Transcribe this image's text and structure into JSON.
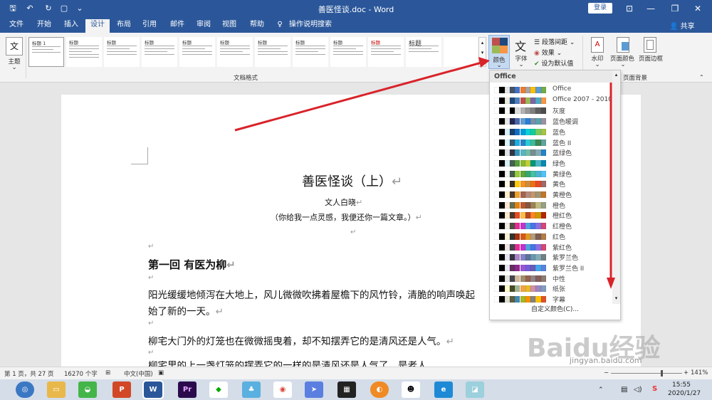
{
  "titlebar": {
    "document_title": "善医怪谈.doc - Word",
    "login_label": "登录",
    "share_label": "共享"
  },
  "tabs": [
    "文件",
    "开始",
    "插入",
    "设计",
    "布局",
    "引用",
    "邮件",
    "审阅",
    "视图",
    "帮助",
    "操作说明搜索"
  ],
  "ribbon": {
    "theme_label": "主题",
    "styles_group_label": "文档格式",
    "thumb_titles": [
      "标题 1",
      "标题",
      "标题",
      "标题",
      "标题",
      "标题",
      "标题",
      "标题",
      "标题",
      "标题",
      "标题"
    ],
    "colors_label": "颜色",
    "fonts_label": "字体",
    "paragraph_spacing_label": "段落间距",
    "effects_label": "效果",
    "set_default_label": "设为默认值",
    "watermark_label": "水印",
    "page_color_label": "页面颜色",
    "page_border_label": "页面边框",
    "page_bg_group_label": "页面背景"
  },
  "colors_dropdown": {
    "header": "Office",
    "custom_label": "自定义颜色(C)...",
    "items": [
      {
        "name": "Office",
        "colors": [
          "#ffffff",
          "#000000",
          "#e7e6e6",
          "#44546a",
          "#4472c4",
          "#ed7d31",
          "#a5a5a5",
          "#ffc000",
          "#5b9bd5",
          "#70ad47"
        ]
      },
      {
        "name": "Office 2007 - 2010",
        "colors": [
          "#ffffff",
          "#000000",
          "#eeece1",
          "#1f497d",
          "#4f81bd",
          "#c0504d",
          "#9bbb59",
          "#8064a2",
          "#4bacc6",
          "#f79646"
        ]
      },
      {
        "name": "灰度",
        "colors": [
          "#ffffff",
          "#000000",
          "#f8f8f8",
          "#000000",
          "#dddddd",
          "#b2b2b2",
          "#969696",
          "#808080",
          "#5f5f5f",
          "#4d4d4d"
        ]
      },
      {
        "name": "蓝色暖调",
        "colors": [
          "#ffffff",
          "#000000",
          "#e7e6e6",
          "#242852",
          "#4a66ac",
          "#629dd1",
          "#297fd5",
          "#7f8fa9",
          "#5aa2ae",
          "#9d90a0"
        ]
      },
      {
        "name": "蓝色",
        "colors": [
          "#ffffff",
          "#000000",
          "#dbeff9",
          "#17406d",
          "#0f6fc6",
          "#009dd9",
          "#0bd0d9",
          "#10cf9b",
          "#7cca62",
          "#a5c249"
        ]
      },
      {
        "name": "蓝色 II",
        "colors": [
          "#ffffff",
          "#000000",
          "#dbf5f9",
          "#335b74",
          "#1cade4",
          "#2683c6",
          "#27ced7",
          "#42ba97",
          "#3e8853",
          "#62a39f"
        ]
      },
      {
        "name": "蓝绿色",
        "colors": [
          "#ffffff",
          "#000000",
          "#dfe3e5",
          "#373545",
          "#3494ba",
          "#58b6c0",
          "#75bda7",
          "#7a8c8e",
          "#84acb6",
          "#2683c6"
        ]
      },
      {
        "name": "绿色",
        "colors": [
          "#ffffff",
          "#000000",
          "#dbeff9",
          "#455f51",
          "#549e39",
          "#8ab833",
          "#c0cf3a",
          "#029676",
          "#4ab5c4",
          "#0989b1"
        ]
      },
      {
        "name": "黄绿色",
        "colors": [
          "#ffffff",
          "#000000",
          "#f2f2f2",
          "#455f51",
          "#99cb38",
          "#63a537",
          "#37a76f",
          "#44c1a3",
          "#4eb3cf",
          "#51c3f9"
        ]
      },
      {
        "name": "黄色",
        "colors": [
          "#ffffff",
          "#000000",
          "#fef8e6",
          "#39302a",
          "#ffca08",
          "#f8931d",
          "#ce8d3e",
          "#ec7016",
          "#e64823",
          "#9c6a6a"
        ]
      },
      {
        "name": "黄橙色",
        "colors": [
          "#ffffff",
          "#000000",
          "#fbeec9",
          "#4e3b30",
          "#f0a22e",
          "#a5644e",
          "#b58b80",
          "#c3986d",
          "#a19574",
          "#c17529"
        ]
      },
      {
        "name": "橙色",
        "colors": [
          "#ffffff",
          "#000000",
          "#fbe6d5",
          "#637052",
          "#e48312",
          "#bd582c",
          "#865640",
          "#9b8357",
          "#c2bc80",
          "#94a088"
        ]
      },
      {
        "name": "橙红色",
        "colors": [
          "#ffffff",
          "#000000",
          "#fbe9d0",
          "#4e3b30",
          "#e84c22",
          "#ffbd47",
          "#b64926",
          "#ff8427",
          "#cc9900",
          "#b22600"
        ]
      },
      {
        "name": "红橙色",
        "colors": [
          "#ffffff",
          "#000000",
          "#f2ebe2",
          "#505046",
          "#e32d91",
          "#c830cc",
          "#4ea6dc",
          "#4775e7",
          "#8971e1",
          "#d54773"
        ]
      },
      {
        "name": "红色",
        "colors": [
          "#ffffff",
          "#000000",
          "#f8f1d4",
          "#323232",
          "#a5300f",
          "#d55816",
          "#e19825",
          "#b19c7d",
          "#7f5f52",
          "#b27d49"
        ]
      },
      {
        "name": "紫红色",
        "colors": [
          "#ffffff",
          "#000000",
          "#f2e4e4",
          "#454551",
          "#e32d91",
          "#c830cc",
          "#4ea6dc",
          "#4775e7",
          "#8971e1",
          "#d54773"
        ]
      },
      {
        "name": "紫罗兰色",
        "colors": [
          "#ffffff",
          "#000000",
          "#e8e4f0",
          "#373545",
          "#ad84c6",
          "#8784c7",
          "#5d739a",
          "#6997af",
          "#84acb6",
          "#6f8183"
        ]
      },
      {
        "name": "紫罗兰色 II",
        "colors": [
          "#ffffff",
          "#000000",
          "#e9e5f2",
          "#632e62",
          "#92278f",
          "#9b57d3",
          "#755dd9",
          "#665eb8",
          "#45a5ed",
          "#5982db"
        ]
      },
      {
        "name": "中性",
        "colors": [
          "#ffffff",
          "#000000",
          "#e4e2dd",
          "#454551",
          "#d2b99e",
          "#a28e6a",
          "#956251",
          "#918485",
          "#855d5d",
          "#8c7b70"
        ]
      },
      {
        "name": "纸张",
        "colors": [
          "#ffffff",
          "#000000",
          "#fefac9",
          "#444d26",
          "#a5b592",
          "#f3a447",
          "#e7bc29",
          "#d092a7",
          "#9c85c0",
          "#809ec2"
        ]
      },
      {
        "name": "字幕",
        "colors": [
          "#ffffff",
          "#000000",
          "#ddddd1",
          "#5e5e3e",
          "#418ab3",
          "#a6b727",
          "#f69200",
          "#838383",
          "#fec306",
          "#df5327"
        ]
      }
    ]
  },
  "document": {
    "title": "善医怪谈（上）",
    "author": "文人白晓",
    "subtitle": "（你给我一点灵感，我便还你一篇文章。）",
    "chapter": "第一回  有医为柳",
    "para1_line1": "阳光缓缓地倾泻在大地上，风儿微微吹拂着屋檐下的风竹铃，清脆的响声唤起",
    "para1_line2": "始了新的一天。",
    "para2": "柳宅大门外的灯笼也在微微摇曳着，却不知摆弄它的是清风还是人气。",
    "para3_partial": "柳宅里的上一盏灯笼的摆弄它的一样的是清风还是人气了，是老人"
  },
  "statusbar": {
    "page_info": "第 1 页，共 27 页",
    "word_count": "16270 个字",
    "language": "中文(中国)",
    "zoom": "141%"
  },
  "taskbar": {
    "time": "15:55",
    "date": "2020/1/27"
  },
  "watermark": {
    "text": "Baidu经验",
    "url": "jingyan.baidu.com"
  },
  "colors": {
    "title_blue": "#2b579a",
    "arrow_red": "#d9232a"
  }
}
